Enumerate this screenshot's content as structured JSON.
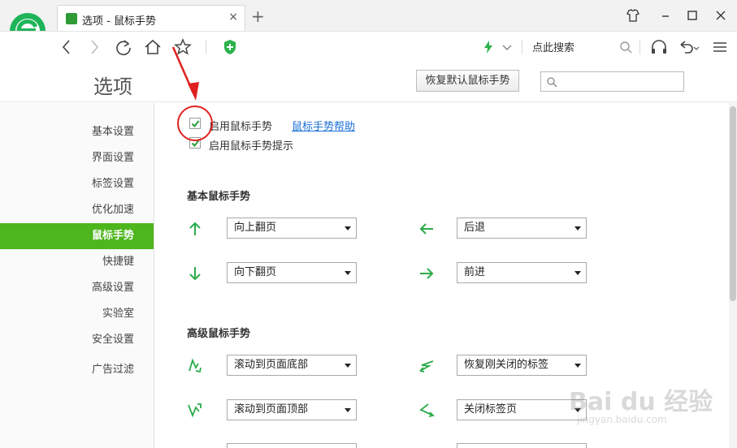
{
  "tab": {
    "title": "选项 - 鼠标手势",
    "close": "×"
  },
  "new_tab": "+",
  "toolbar": {
    "search_text": "点此搜索"
  },
  "page": {
    "title": "选项",
    "restore_button": "恢复默认鼠标手势",
    "search_placeholder": ""
  },
  "sidebar": {
    "items": [
      {
        "label": "基本设置",
        "active": false
      },
      {
        "label": "界面设置",
        "active": false
      },
      {
        "label": "标签设置",
        "active": false
      },
      {
        "label": "优化加速",
        "active": false
      },
      {
        "label": "鼠标手势",
        "active": true
      },
      {
        "label": "快捷键",
        "active": false
      },
      {
        "label": "高级设置",
        "active": false
      },
      {
        "label": "实验室",
        "active": false
      },
      {
        "label": "安全设置",
        "active": false
      },
      {
        "label": "广告过滤",
        "active": false
      }
    ]
  },
  "options": {
    "enable_gesture": {
      "label": "启用鼠标手势",
      "checked": true
    },
    "gesture_help_link": "鼠标手势帮助",
    "enable_gesture_tip": {
      "label": "启用鼠标手势提示",
      "checked": true
    }
  },
  "basic": {
    "title": "基本鼠标手势",
    "gestures": [
      {
        "icon": "arrow-up-icon",
        "value": "向上翻页"
      },
      {
        "icon": "arrow-left-icon",
        "value": "后退"
      },
      {
        "icon": "arrow-down-icon",
        "value": "向下翻页"
      },
      {
        "icon": "arrow-right-icon",
        "value": "前进"
      }
    ]
  },
  "advanced": {
    "title": "高级鼠标手势",
    "gestures": [
      {
        "icon": "up-down-gesture-icon",
        "value": "滚动到页面底部"
      },
      {
        "icon": "left-right-gesture-icon",
        "value": "恢复刚关闭的标签"
      },
      {
        "icon": "down-up-gesture-icon",
        "value": "滚动到页面顶部"
      },
      {
        "icon": "right-left-gesture-icon",
        "value": "关闭标签页"
      }
    ]
  },
  "watermark": {
    "text": "Bai du 经验",
    "sub": "jingyan.baidu.com"
  },
  "colors": {
    "accent": "#4db61d",
    "link": "#1a6fd4",
    "annotation": "#e02020",
    "arrow": "#2bab4a"
  }
}
